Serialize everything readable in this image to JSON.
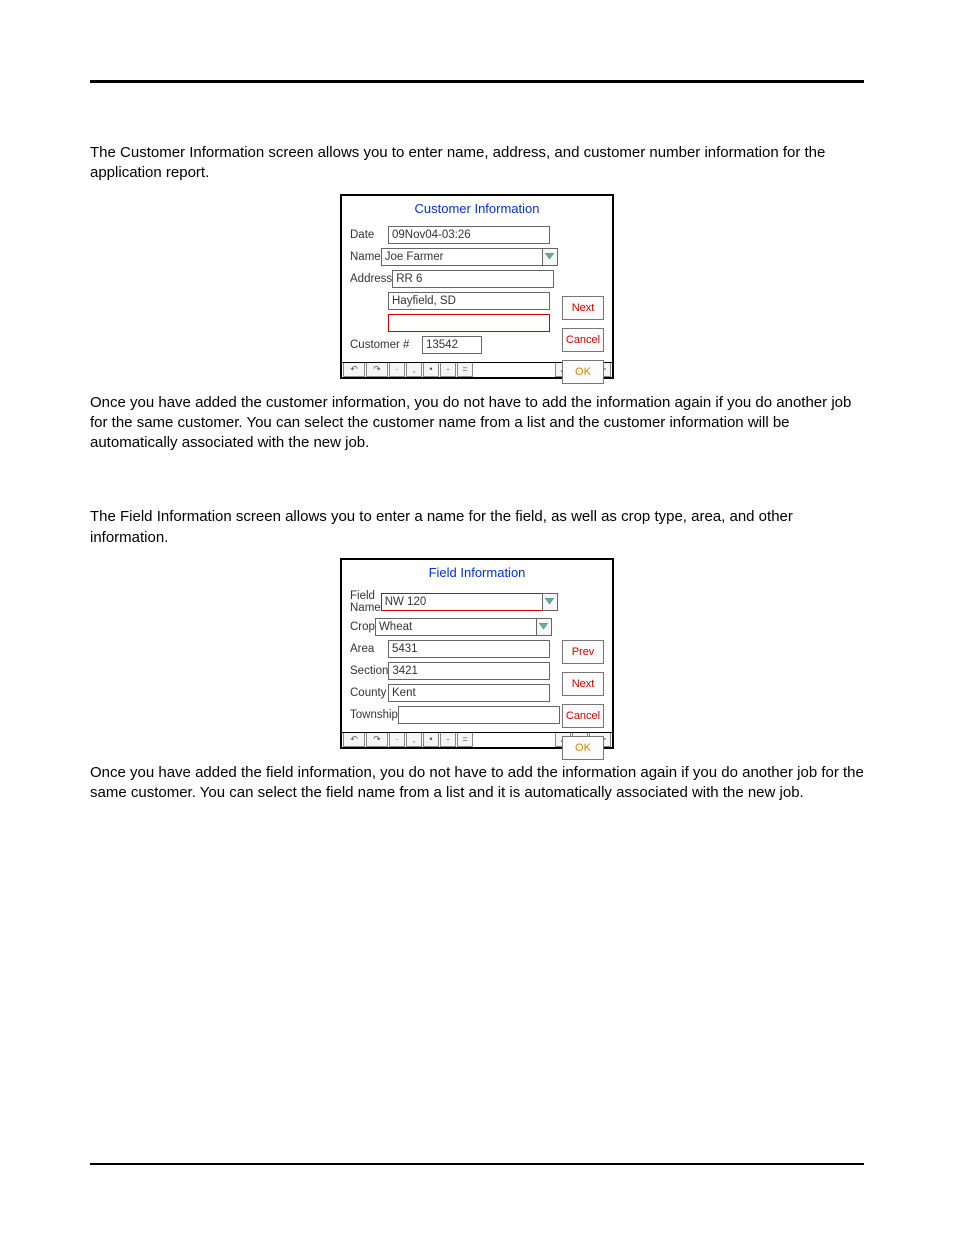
{
  "intro1": "The Customer Information screen allows you to enter name, address, and customer number information for the application report.",
  "para1": "Once you have added the customer information, you do not have to add the information again if you do another job for the same customer. You can select the customer name from a list and the customer information will be automatically associated with the new job.",
  "intro2": "The Field Information screen allows you to enter a name for the field, as well as crop type, area, and other information.",
  "para2": "Once you have added the field information, you do not have to add the information again if you do another job for the same customer. You can select the field name from a list and it is automatically associated with the new job.",
  "cust": {
    "title": "Customer Information",
    "labels": {
      "date": "Date",
      "name": "Name",
      "address": "Address",
      "customer": "Customer #"
    },
    "date": "09Nov04-03:26",
    "name": "Joe Farmer",
    "addr1": "RR 6",
    "addr2": "Hayfield, SD",
    "addr3": "",
    "customer": "13542",
    "buttons": {
      "next": "Next",
      "cancel": "Cancel",
      "ok": "OK"
    }
  },
  "field": {
    "title": "Field Information",
    "labels": {
      "fieldname": "Field Name",
      "crop": "Crop",
      "area": "Area",
      "section": "Section",
      "county": "County",
      "township": "Township"
    },
    "fieldname": "NW 120",
    "crop": "Wheat",
    "area": "5431",
    "section": "3421",
    "county": "Kent",
    "township": "",
    "buttons": {
      "prev": "Prev",
      "next": "Next",
      "cancel": "Cancel",
      "ok": "OK"
    }
  }
}
